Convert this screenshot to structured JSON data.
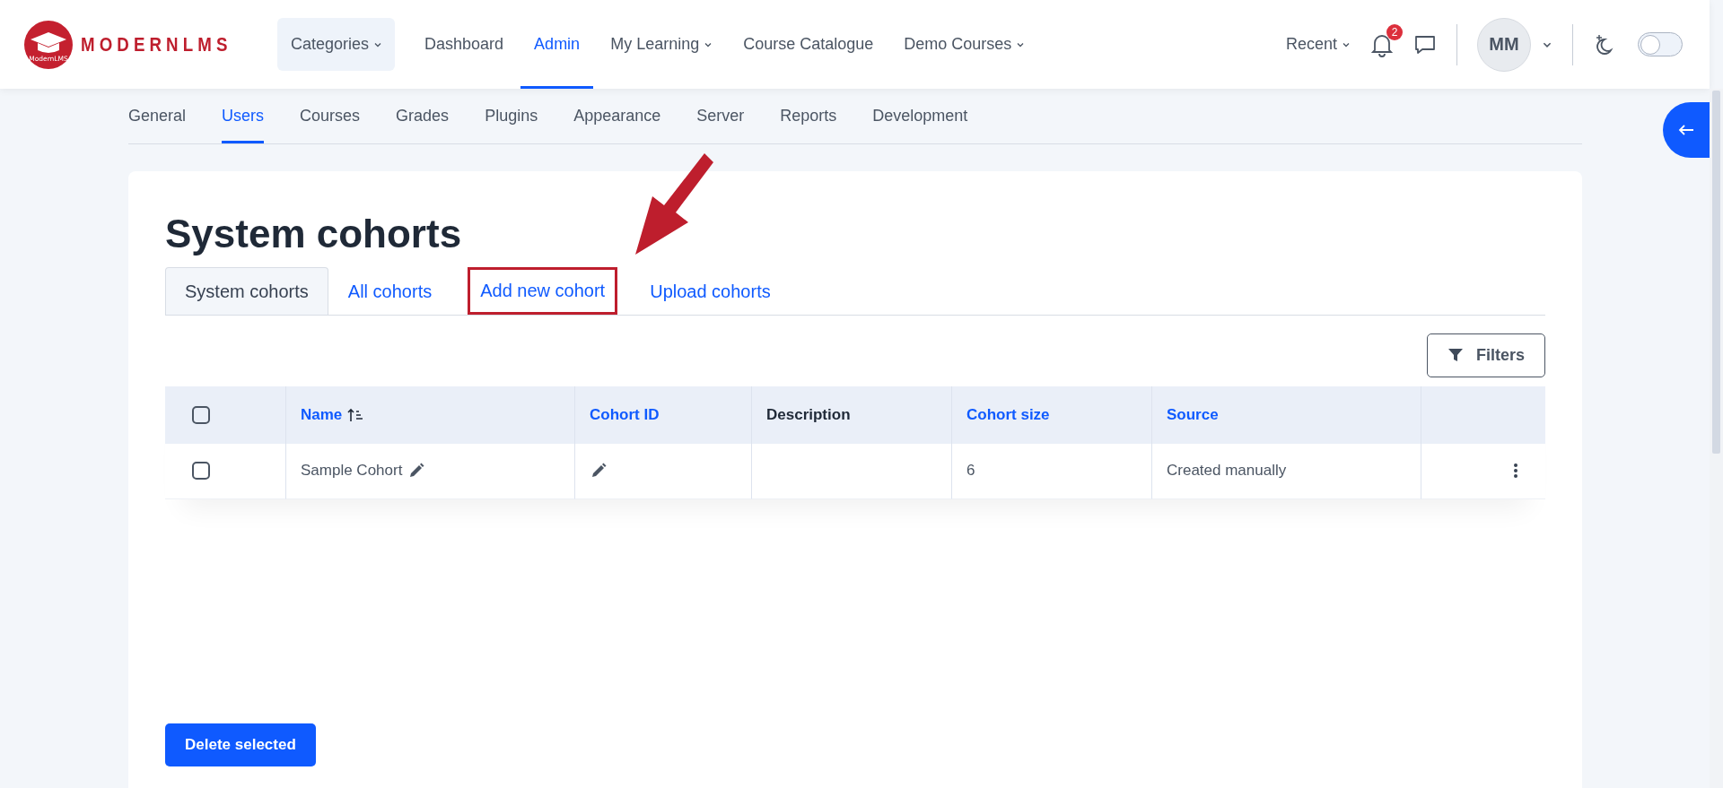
{
  "logo": {
    "name": "MODERNLMS",
    "subtext": "ModernLMS"
  },
  "nav": [
    {
      "label": "Categories",
      "dropdown": true,
      "kind": "button",
      "selected": false
    },
    {
      "label": "Dashboard",
      "dropdown": false,
      "kind": "link",
      "selected": false
    },
    {
      "label": "Admin",
      "dropdown": false,
      "kind": "link",
      "selected": true
    },
    {
      "label": "My Learning",
      "dropdown": true,
      "kind": "link",
      "selected": false
    },
    {
      "label": "Course Catalogue",
      "dropdown": false,
      "kind": "link",
      "selected": false
    },
    {
      "label": "Demo Courses",
      "dropdown": true,
      "kind": "link",
      "selected": false
    }
  ],
  "recent": {
    "label": "Recent"
  },
  "notifications": {
    "count": "2"
  },
  "avatar": {
    "initials": "MM"
  },
  "dark_mode": {
    "on": false
  },
  "admin_tabs": [
    {
      "label": "General",
      "selected": false
    },
    {
      "label": "Users",
      "selected": true
    },
    {
      "label": "Courses",
      "selected": false
    },
    {
      "label": "Grades",
      "selected": false
    },
    {
      "label": "Plugins",
      "selected": false
    },
    {
      "label": "Appearance",
      "selected": false
    },
    {
      "label": "Server",
      "selected": false
    },
    {
      "label": "Reports",
      "selected": false
    },
    {
      "label": "Development",
      "selected": false
    }
  ],
  "page_title": "System cohorts",
  "tabs": [
    {
      "label": "System cohorts",
      "selected": true,
      "highlighted": false
    },
    {
      "label": "All cohorts",
      "selected": false,
      "highlighted": false
    },
    {
      "label": "Add new cohort",
      "selected": false,
      "highlighted": true
    },
    {
      "label": "Upload cohorts",
      "selected": false,
      "highlighted": false
    }
  ],
  "filters_button": "Filters",
  "table": {
    "select_all": {
      "checked": false
    },
    "columns": [
      {
        "label": "Name",
        "sortable": true,
        "sorted": true
      },
      {
        "label": "Cohort ID",
        "sortable": true,
        "sorted": false
      },
      {
        "label": "Description",
        "sortable": false,
        "sorted": false
      },
      {
        "label": "Cohort size",
        "sortable": true,
        "sorted": false
      },
      {
        "label": "Source",
        "sortable": true,
        "sorted": false
      }
    ],
    "rows": [
      {
        "checked": false,
        "name": "Sample Cohort",
        "size": "6",
        "source": "Created manually"
      }
    ]
  },
  "delete_button": "Delete selected"
}
